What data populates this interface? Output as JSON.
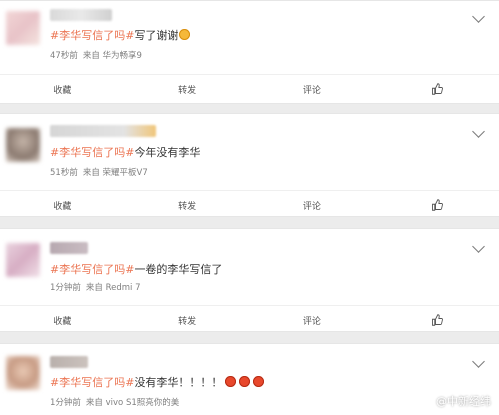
{
  "actions": {
    "favorite": "收藏",
    "repost": "转发",
    "comment": "评论"
  },
  "posts": [
    {
      "hashtag": "#李华写信了吗#",
      "text": "写了谢谢",
      "time": "47秒前",
      "source": "来自 华为畅享9",
      "emoji": "surprised-face"
    },
    {
      "hashtag": "#李华写信了吗#",
      "text": "今年没有李华",
      "time": "51秒前",
      "source": "来自 荣耀平板V7"
    },
    {
      "hashtag": "#李华写信了吗#",
      "text": "一卷的李华写信了",
      "time": "1分钟前",
      "source": "来自 Redmi 7"
    },
    {
      "hashtag": "#李华写信了吗#",
      "text": "没有李华！！！！",
      "time": "1分钟前",
      "source": "来自 vivo S1照亮你的美",
      "emoji": "angry-face"
    }
  ],
  "watermark": "@中新经纬",
  "colors": {
    "hashtag": "#eb7350",
    "background": "#ececec",
    "card": "#ffffff"
  }
}
